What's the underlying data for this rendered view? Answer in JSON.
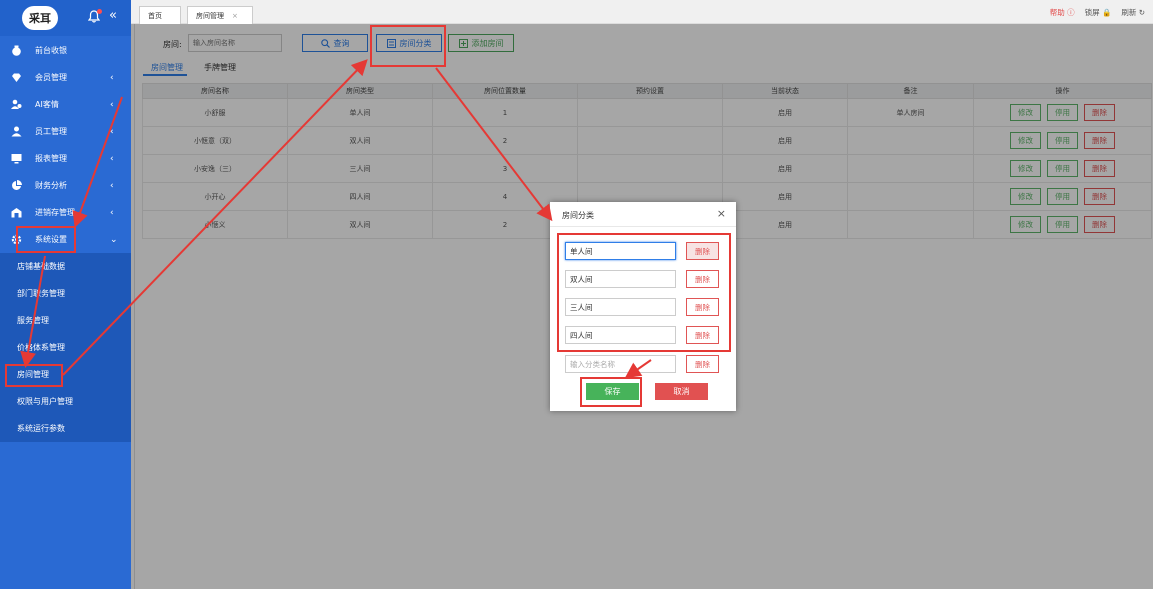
{
  "sidebar": {
    "logo": "采耳",
    "items": [
      {
        "label": "前台收银",
        "icon": "money-bag-icon",
        "arrow": ""
      },
      {
        "label": "会员管理",
        "icon": "diamond-icon",
        "arrow": "‹"
      },
      {
        "label": "AI客情",
        "icon": "users-icon",
        "arrow": "‹"
      },
      {
        "label": "员工管理",
        "icon": "user-icon",
        "arrow": "‹"
      },
      {
        "label": "报表管理",
        "icon": "monitor-icon",
        "arrow": "‹"
      },
      {
        "label": "财务分析",
        "icon": "pie-chart-icon",
        "arrow": "‹"
      },
      {
        "label": "进销存管理",
        "icon": "warehouse-icon",
        "arrow": "‹"
      },
      {
        "label": "系统设置",
        "icon": "gear-icon",
        "arrow": "⌄"
      }
    ],
    "sub_items": [
      "店铺基础数据",
      "部门职务管理",
      "服务管理",
      "价格体系管理",
      "房间管理",
      "权限与用户管理",
      "系统运行参数"
    ]
  },
  "topbar": {
    "tabs": [
      "首页",
      "房间管理"
    ],
    "tab_close": "×",
    "help": "帮助 ⓘ",
    "lock": "锁屏 🔒",
    "refresh": "刷新 ↻"
  },
  "search": {
    "label": "房间:",
    "placeholder": "输入房间名称",
    "query_btn": "查询",
    "category_btn": "房间分类",
    "add_btn": "添加房间"
  },
  "sub_tabs": [
    "房间管理",
    "手牌管理"
  ],
  "table": {
    "headers": [
      "房间名称",
      "房间类型",
      "房间位置数量",
      "预约设置",
      "当前状态",
      "备注",
      "操作"
    ],
    "rows": [
      {
        "name": "小舒服",
        "type": "单人间",
        "count": "1",
        "booking": "",
        "status": "启用",
        "note": "单人房间"
      },
      {
        "name": "小惬意（双）",
        "type": "双人间",
        "count": "2",
        "booking": "",
        "status": "启用",
        "note": ""
      },
      {
        "name": "小安逸（三）",
        "type": "三人间",
        "count": "3",
        "booking": "",
        "status": "启用",
        "note": ""
      },
      {
        "name": "小开心",
        "type": "四人间",
        "count": "4",
        "booking": "",
        "status": "启用",
        "note": ""
      },
      {
        "name": "小惬义",
        "type": "双人间",
        "count": "2",
        "booking": "",
        "status": "启用",
        "note": ""
      }
    ],
    "op_edit": "修改",
    "op_disable": "停用",
    "op_delete": "删除"
  },
  "modal": {
    "title": "房间分类",
    "close": "×",
    "categories": [
      "单人间",
      "双人间",
      "三人间",
      "四人间"
    ],
    "new_placeholder": "输入分类名称",
    "delete_label": "删除",
    "save": "保存",
    "cancel": "取消"
  },
  "colors": {
    "sidebar": "#2a6ad3",
    "primary": "#2f7ee8",
    "success": "#47b35a",
    "danger": "#e15151",
    "annotation": "#e53935"
  }
}
